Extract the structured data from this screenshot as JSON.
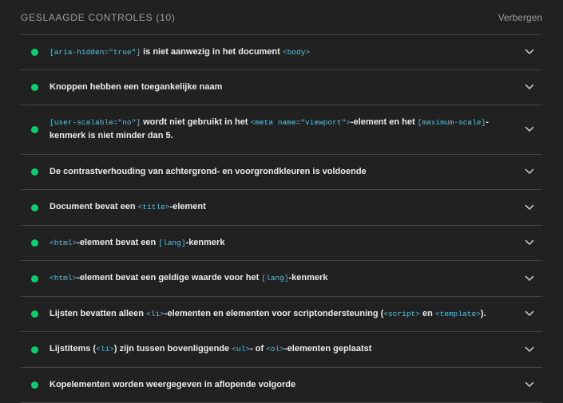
{
  "header": {
    "title": "GESLAAGDE CONTROLES (10)",
    "toggle_label": "Verbergen"
  },
  "colors": {
    "pass": "#0cce6b",
    "code": "#53c5e6",
    "background": "#212121",
    "divider": "#424242"
  },
  "audits": [
    {
      "id": "aria-hidden-body",
      "icon": "pass-dot-icon",
      "parts": [
        {
          "type": "code",
          "text": "[aria-hidden=\"true\"]"
        },
        {
          "type": "text",
          "text": " is niet aanwezig in het document "
        },
        {
          "type": "code",
          "text": "<body>"
        }
      ]
    },
    {
      "id": "button-name",
      "icon": "pass-dot-icon",
      "parts": [
        {
          "type": "text",
          "text": "Knoppen hebben een toegankelijke naam"
        }
      ]
    },
    {
      "id": "meta-viewport",
      "icon": "pass-dot-icon",
      "parts": [
        {
          "type": "code",
          "text": "[user-scalable=\"no\"]"
        },
        {
          "type": "text",
          "text": " wordt niet gebruikt in het "
        },
        {
          "type": "code",
          "text": "<meta name=\"viewport\">"
        },
        {
          "type": "text",
          "text": "-element en het "
        },
        {
          "type": "code",
          "text": "[maximum-scale]"
        },
        {
          "type": "text",
          "text": "-kenmerk is niet minder dan 5."
        }
      ]
    },
    {
      "id": "color-contrast",
      "icon": "pass-dot-icon",
      "parts": [
        {
          "type": "text",
          "text": "De contrastverhouding van achtergrond- en voorgrondkleuren is voldoende"
        }
      ]
    },
    {
      "id": "document-title",
      "icon": "pass-dot-icon",
      "parts": [
        {
          "type": "text",
          "text": "Document bevat een "
        },
        {
          "type": "code",
          "text": "<title>"
        },
        {
          "type": "text",
          "text": "-element"
        }
      ]
    },
    {
      "id": "html-has-lang",
      "icon": "pass-dot-icon",
      "parts": [
        {
          "type": "code",
          "text": "<html>"
        },
        {
          "type": "text",
          "text": "-element bevat een "
        },
        {
          "type": "code",
          "text": "[lang]"
        },
        {
          "type": "text",
          "text": "-kenmerk"
        }
      ]
    },
    {
      "id": "html-lang-valid",
      "icon": "pass-dot-icon",
      "parts": [
        {
          "type": "code",
          "text": "<html>"
        },
        {
          "type": "text",
          "text": "-element bevat een geldige waarde voor het "
        },
        {
          "type": "code",
          "text": "[lang]"
        },
        {
          "type": "text",
          "text": "-kenmerk"
        }
      ]
    },
    {
      "id": "list",
      "icon": "pass-dot-icon",
      "parts": [
        {
          "type": "text",
          "text": "Lijsten bevatten alleen "
        },
        {
          "type": "code",
          "text": "<li>"
        },
        {
          "type": "text",
          "text": "-elementen en elementen voor scriptondersteuning ("
        },
        {
          "type": "code",
          "text": "<script>"
        },
        {
          "type": "text",
          "text": " en "
        },
        {
          "type": "code",
          "text": "<template>"
        },
        {
          "type": "text",
          "text": ")."
        }
      ]
    },
    {
      "id": "listitem",
      "icon": "pass-dot-icon",
      "parts": [
        {
          "type": "text",
          "text": "Lijstitems ("
        },
        {
          "type": "code",
          "text": "<li>"
        },
        {
          "type": "text",
          "text": ") zijn tussen bovenliggende "
        },
        {
          "type": "code",
          "text": "<ul>"
        },
        {
          "type": "text",
          "text": "- of "
        },
        {
          "type": "code",
          "text": "<ol>"
        },
        {
          "type": "text",
          "text": "-elementen geplaatst"
        }
      ]
    },
    {
      "id": "heading-order",
      "icon": "pass-dot-icon",
      "parts": [
        {
          "type": "text",
          "text": "Kopelementen worden weergegeven in aflopende volgorde"
        }
      ]
    }
  ]
}
